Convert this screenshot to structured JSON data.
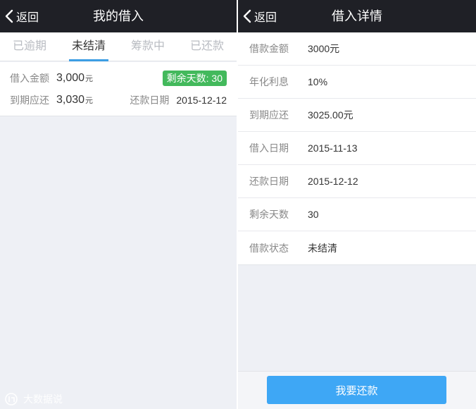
{
  "left": {
    "navbar": {
      "back_label": "返回",
      "title": "我的借入"
    },
    "tabs": [
      {
        "label": "已逾期",
        "active": false
      },
      {
        "label": "未结清",
        "active": true
      },
      {
        "label": "筹款中",
        "active": false
      },
      {
        "label": "已还款",
        "active": false
      }
    ],
    "loan": {
      "borrow_label": "借入金额",
      "borrow_amount": "3,000",
      "borrow_unit": "元",
      "remaining_badge": "剩余天数: 30",
      "due_label": "到期应还",
      "due_amount": "3,030",
      "due_unit": "元",
      "repay_date_label": "还款日期",
      "repay_date": "2015-12-12"
    },
    "watermark": "大数据说"
  },
  "right": {
    "navbar": {
      "back_label": "返回",
      "title": "借入详情"
    },
    "details": [
      {
        "label": "借款金额",
        "value": "3000元"
      },
      {
        "label": "年化利息",
        "value": "10%"
      },
      {
        "label": "到期应还",
        "value": "3025.00元"
      },
      {
        "label": "借入日期",
        "value": "2015-11-13"
      },
      {
        "label": "还款日期",
        "value": "2015-12-12"
      },
      {
        "label": "剩余天数",
        "value": "30"
      },
      {
        "label": "借款状态",
        "value": "未结清"
      }
    ],
    "repay_button": "我要还款"
  },
  "colors": {
    "navbar_bg": "#1f2026",
    "accent": "#3d9ee4",
    "badge_green": "#43b95c",
    "button_blue": "#3ea7f5",
    "page_bg": "#eef0f5"
  }
}
